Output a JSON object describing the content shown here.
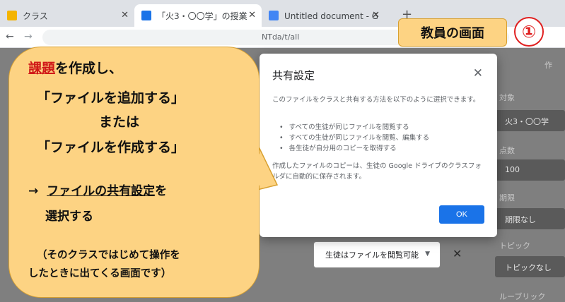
{
  "browser": {
    "tabs": [
      {
        "title": "クラス",
        "favicon_color": "#f4b400"
      },
      {
        "title": "「火3・〇〇学」の授業",
        "favicon_color": "#1a73e8"
      },
      {
        "title": "Untitled document - Google ドキ",
        "favicon_color": "#4285f4"
      }
    ],
    "url_fragment": "NTda/t/all"
  },
  "background_page": {
    "right_panel": {
      "target_label": "対象",
      "target_value": "火3・〇〇学",
      "points_label": "点数",
      "points_value": "100",
      "due_label": "期限",
      "due_value": "期限なし",
      "topic_label": "トピック",
      "topic_value": "トピックなし",
      "rubric_label": "ルーブリック",
      "top_icon": "作"
    },
    "sharing_select_value": "生徒はファイルを閲覧可能"
  },
  "dialog": {
    "title": "共有設定",
    "intro": "このファイルをクラスと共有する方法を以下のように選択できます。",
    "options": [
      "すべての生徒が同じファイルを閲覧する",
      "すべての生徒が同じファイルを閲覧、編集する",
      "各生徒が自分用のコピーを取得する"
    ],
    "note": "作成したファイルのコピーは、生徒の Google ドライブのクラスフォルダに自動的に保存されます。",
    "ok_label": "OK"
  },
  "callout": {
    "line1_keyword": "課題",
    "line1_rest": "を作成し、",
    "line2": "「ファイルを追加する」",
    "line3": "または",
    "line4": "「ファイルを作成する」",
    "line5_arrow": "→",
    "line5_keyword": "ファイルの共有設定",
    "line5_rest": "を",
    "line6": "選択する",
    "note_line1": "（そのクラスではじめて操作を",
    "note_line2": "したときに出てくる画面です）"
  },
  "role_label": "教員の画面",
  "step_number": "①",
  "colors": {
    "callout_fill": "#fdd383",
    "callout_border": "#d8a030",
    "keyword_red": "#d01818",
    "ok_blue": "#1a73e8",
    "badge_red": "#e02020"
  }
}
